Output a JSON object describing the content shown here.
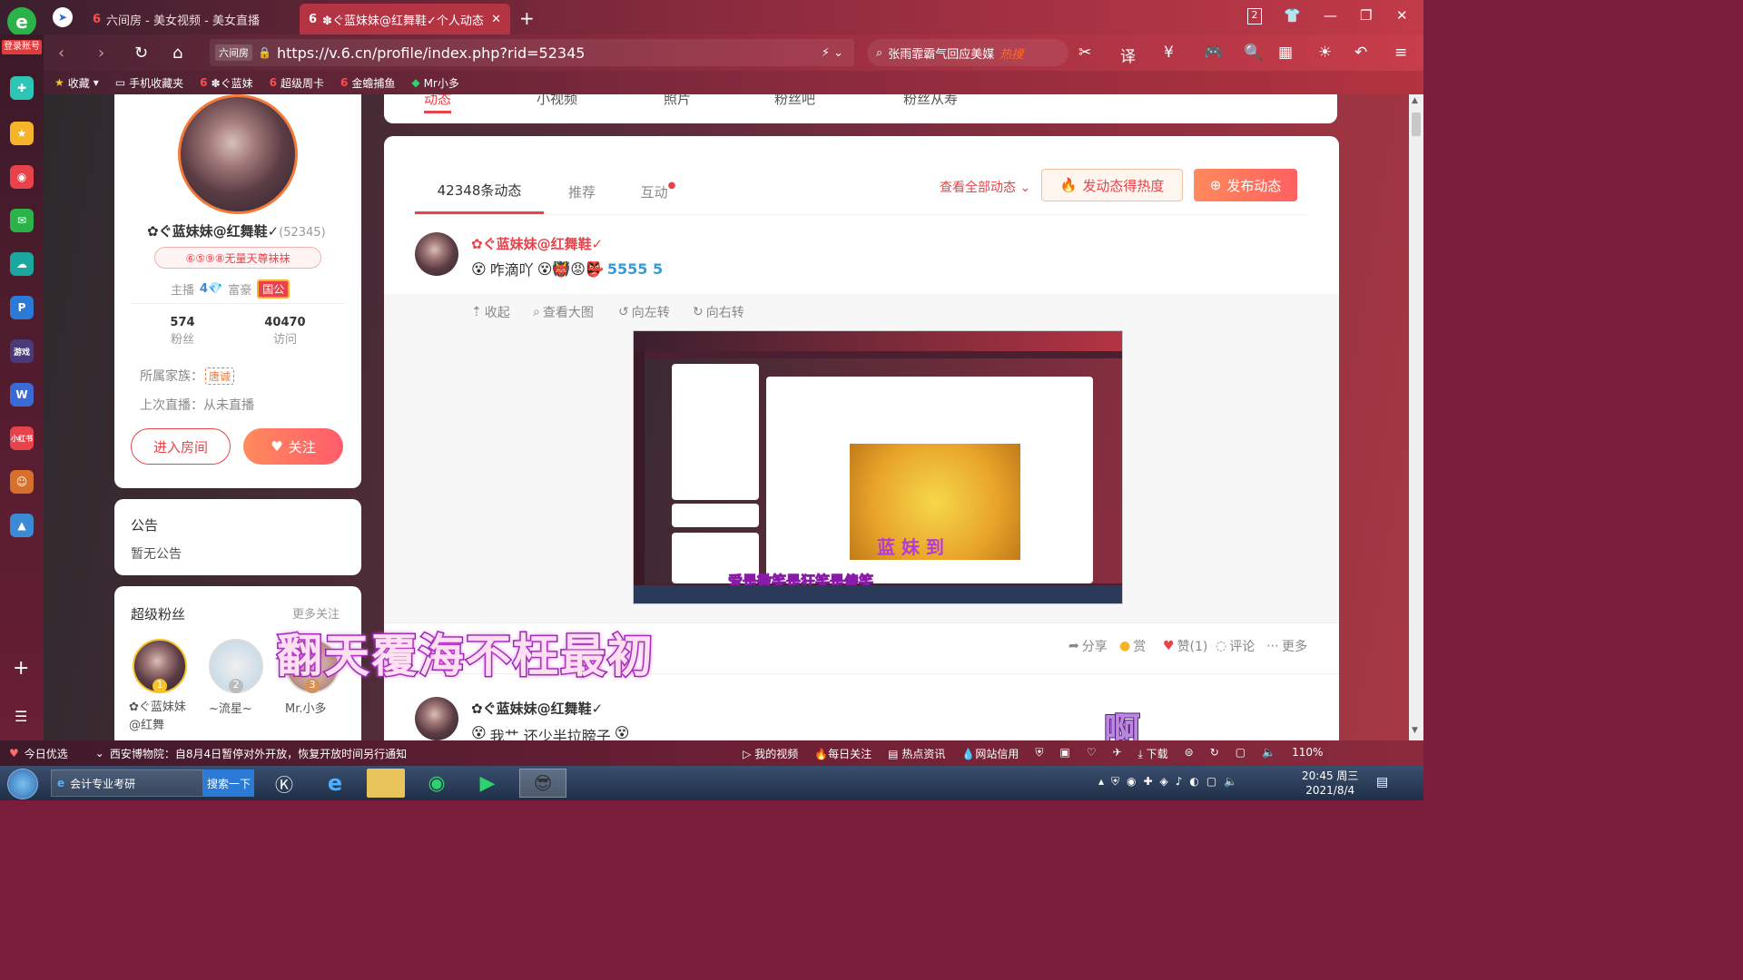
{
  "browser": {
    "tabs": [
      {
        "label": "六间房 - 美女视频 - 美女直播"
      },
      {
        "label": "✽ぐ蓝妹妹@红舞鞋✓个人动态"
      }
    ],
    "tab_count": "2",
    "url": "https://v.6.cn/profile/index.php?rid=52345",
    "url_badge": "六间房",
    "search_text": "张雨霏霸气回应美媒",
    "search_badge": "热搜",
    "login_label": "登录账号",
    "bookmarks": [
      {
        "label": "收藏"
      },
      {
        "label": "手机收藏夹"
      },
      {
        "label": "✽ぐ蓝妹"
      },
      {
        "label": "超级周卡"
      },
      {
        "label": "金蟾捕鱼"
      },
      {
        "label": "Mr小多"
      }
    ],
    "status_left": "今日优选",
    "status_news": "西安博物院：自8月4日暂停对外开放，恢复开放时间另行通知",
    "status_items": [
      {
        "label": "我的视频"
      },
      {
        "label": "每日关注"
      },
      {
        "label": "热点资讯"
      },
      {
        "label": "网站信用"
      },
      {
        "label": "下载"
      }
    ],
    "zoom": "110%"
  },
  "top_nav": {
    "items": [
      {
        "label": "动态"
      },
      {
        "label": "小视频"
      },
      {
        "label": "照片"
      },
      {
        "label": "粉丝吧"
      },
      {
        "label": "粉丝从寿"
      }
    ]
  },
  "profile": {
    "name": "✿ぐ蓝妹妹@红舞鞋✓",
    "rid": "(52345)",
    "badge_text": "⑥⑤⑨⑧无量天尊袜袜",
    "anchor_label": "主播",
    "anchor_level": "4",
    "rich_label": "富豪",
    "rich_badge": "国公",
    "fans_count": "574",
    "fans_label": "粉丝",
    "visit_count": "40470",
    "visit_label": "访问",
    "family_label": "所属家族：",
    "family_name": "唐诚",
    "last_live": "上次直播：从未直播",
    "enter_room": "进入房间",
    "follow": "关注"
  },
  "notice": {
    "title": "公告",
    "content": "暂无公告"
  },
  "super_fans": {
    "title": "超级粉丝",
    "more": "更多关注",
    "fans": [
      {
        "rank": "1",
        "name": "✿ぐ蓝妹妹@红舞"
      },
      {
        "rank": "2",
        "name": "~流星~"
      },
      {
        "rank": "3",
        "name": "Mr.小多"
      }
    ]
  },
  "feed": {
    "tabs": [
      {
        "label": "42348条动态"
      },
      {
        "label": "推荐"
      },
      {
        "label": "互动"
      }
    ],
    "view_all": "查看全部动态",
    "heat_button": "发动态得热度",
    "publish_button": "发布动态",
    "post1": {
      "author": "✿ぐ蓝妹妹@红舞鞋✓",
      "text": "咋滴吖",
      "toolbar": [
        {
          "label": "收起"
        },
        {
          "label": "查看大图"
        },
        {
          "label": "向左转"
        },
        {
          "label": "向右转"
        }
      ],
      "actions": [
        {
          "label": "分享"
        },
        {
          "label": "赏"
        },
        {
          "label": "赞(1)"
        },
        {
          "label": "评论"
        },
        {
          "label": "更多"
        }
      ]
    },
    "post2": {
      "author": "✿ぐ蓝妹妹@红舞鞋✓",
      "text": "我艹 还少半拉膀子"
    }
  },
  "overlay": {
    "caption": "翻天覆海不枉最初",
    "exclaim": "啊"
  },
  "taskbar": {
    "ie_label": "会计专业考研",
    "search_button": "搜索一下",
    "time": "20:45 周三",
    "date": "2021/8/4"
  },
  "thumbnail": {
    "caption": "爱是微笑是狂笑是傻笑",
    "big_text": "蓝 妹 到"
  }
}
